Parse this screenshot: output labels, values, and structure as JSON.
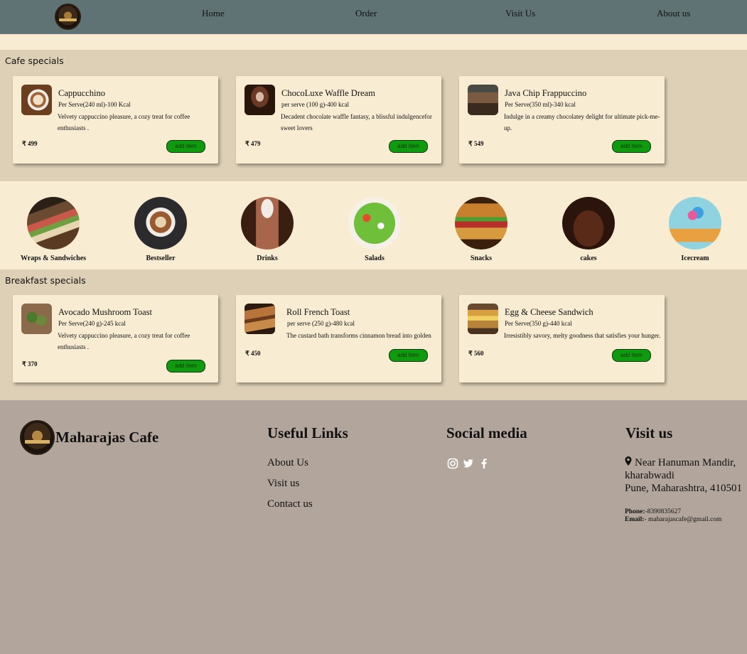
{
  "nav": {
    "links": [
      "Home",
      "Order",
      "Visit Us",
      "About us"
    ]
  },
  "cafe": {
    "title": "Cafe specials",
    "items": [
      {
        "name": "Cappucchino",
        "meta": "Per Serve(240 ml)-100 Kcal",
        "desc": "Velvety cappuccino pleasure, a cozy treat for coffee enthusiasts .",
        "price": "₹ 499",
        "button": "add item"
      },
      {
        "name": "ChocoLuxe Waffle Dream",
        "meta": "per serve (100 g)-400 kcal",
        "desc": "Decadent chocolate waffle fantasy, a blissful indulgencefor sweet lovers",
        "price": "₹ 479",
        "button": "add item"
      },
      {
        "name": "Java Chip Frappuccino",
        "meta": "Per Serve(350 ml)-340 kcal",
        "desc": "Indulge in a creamy chocolatey delight for ultimate pick-me-up.",
        "price": "₹ 549",
        "button": "add item"
      }
    ]
  },
  "categories": [
    "Wraps & Sandwiches",
    "Bestseller",
    "Drinks",
    "Salads",
    "Snacks",
    "cakes",
    "Icecream"
  ],
  "breakfast": {
    "title": "Breakfast specials",
    "items": [
      {
        "name": "Avocado Mushroom Toast",
        "meta": "Per Serve(240 g)-245 kcal",
        "desc": "Velvety cappuccino pleasure, a cozy treat for coffee enthusiasts .",
        "price": "₹ 370",
        "button": "add item"
      },
      {
        "name": "Roll French Toast",
        "meta": "per serve (250 g)-480 kcal",
        "desc": "The custard bath transforms cinnamon bread into golden",
        "price": "₹ 450",
        "button": "add item"
      },
      {
        "name": "Egg & Cheese Sandwich",
        "meta": "Per Serve(350 g)-440 kcal",
        "desc": "Irresistibly savory, melty goodness that satisfies your hunger.",
        "price": "₹ 560",
        "button": "add item"
      }
    ]
  },
  "footer": {
    "brand": "Maharajas Cafe",
    "useful_title": "Useful Links",
    "useful_links": [
      "About Us",
      "Visit us",
      "Contact us"
    ],
    "social_title": "Social media",
    "visit_title": "Visit us",
    "address_lines": [
      "Near Hanuman Mandir, kharabwadi",
      "Pune, Maharashtra, 410501"
    ],
    "phone_label": "Phone:",
    "phone": "-8390835627",
    "email_label": "Email:",
    "email": "- maharajascafe@gmail.com"
  }
}
